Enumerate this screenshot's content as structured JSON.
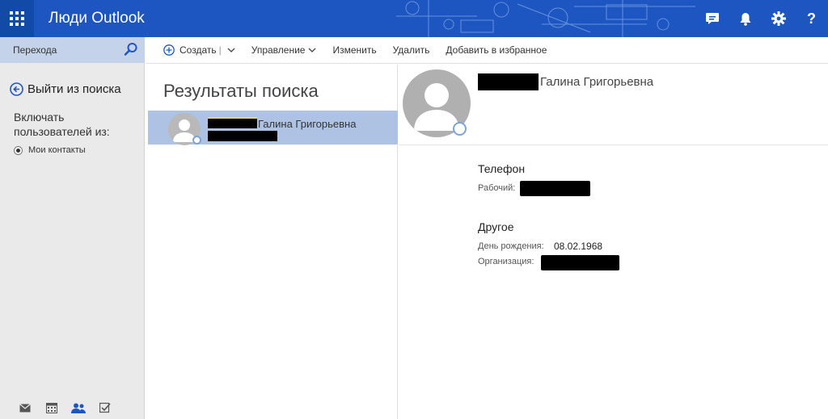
{
  "topbar": {
    "app_title": "Люди Outlook",
    "icons": [
      "chat-icon",
      "bell-icon",
      "gear-icon",
      "help-icon"
    ],
    "help_glyph": "?"
  },
  "leftnav": {
    "search_placeholder": "Перехода",
    "exit_search": "Выйти из поиска",
    "include_label": "Включать пользователей из:",
    "radio_option": "Мои контакты",
    "bottom_icons": [
      "mail-icon",
      "calendar-icon",
      "people-icon",
      "tasks-icon"
    ]
  },
  "cmdbar": {
    "create": "Создать",
    "manage": "Управление",
    "edit": "Изменить",
    "delete": "Удалить",
    "favorite": "Добавить в избранное"
  },
  "results": {
    "title": "Результаты поиска",
    "items": [
      {
        "name": "Галина Григорьевна"
      }
    ]
  },
  "details": {
    "name": "Галина Григорьевна",
    "phone_section": "Телефон",
    "work_label": "Рабочий:",
    "other_section": "Другое",
    "birthday_label": "День рождения:",
    "birthday_value": "08.02.1968",
    "org_label": "Организация:"
  },
  "colors": {
    "topbar": "#1e56c1",
    "waffle_bg": "#124aa8",
    "leftnav_bg": "#eaeaea",
    "search_bg": "#c5d3ea",
    "selected_row": "#aec3e4",
    "accent": "#1e56c1"
  }
}
